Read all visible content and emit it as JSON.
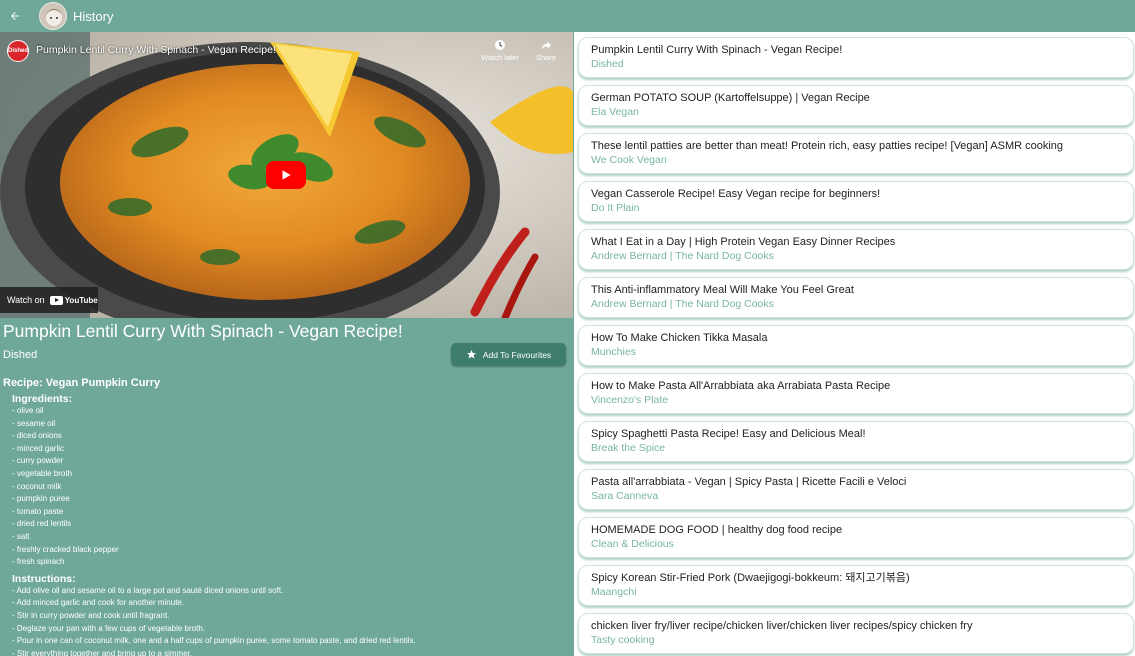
{
  "appbar": {
    "title": "History",
    "back_icon": "arrow-left-icon"
  },
  "player": {
    "title": "Pumpkin Lentil Curry With Spinach - Vegan Recipe!",
    "channel_logo_text": "Dished",
    "watch_later_label": "Watch later",
    "share_label": "Share",
    "watch_on_label": "Watch on",
    "youtube_label": "YouTube"
  },
  "video": {
    "heading": "Pumpkin Lentil Curry With Spinach - Vegan Recipe!",
    "channel": "Dished",
    "fav_button_label": "Add To Favourites"
  },
  "recipe": {
    "title": "Recipe: Vegan Pumpkin Curry",
    "ingredients_heading": "Ingredients:",
    "ingredients": [
      "- olive oil",
      "- sesame oil",
      "- diced onions",
      "- minced garlic",
      "- curry powder",
      "- vegetable broth",
      "- coconut milk",
      "- pumpkin puree",
      "- tomato paste",
      "- dried red lentils",
      "- salt",
      "- freshly cracked black pepper",
      "- fresh spinach"
    ],
    "instructions_heading": "Instructions:",
    "instructions": [
      "- Add olive oil and sesame oil to a large pot and sauté diced onions until soft.",
      "- Add minced garlic and cook for another minute.",
      "- Stir in curry powder and cook until fragrant.",
      "- Deglaze your pan with a few cups of vegetable broth.",
      "- Pour in one can of coconut milk, one and a half cups of pumpkin puree, some tomato paste, and dried red lentils.",
      "- Stir everything together and bring up to a simmer."
    ]
  },
  "history": [
    {
      "title": "Pumpkin Lentil Curry With Spinach - Vegan Recipe!",
      "channel": "Dished"
    },
    {
      "title": "German POTATO SOUP (Kartoffelsuppe) | Vegan Recipe",
      "channel": "Ela Vegan"
    },
    {
      "title": "These lentil patties are better than meat! Protein rich, easy patties recipe! [Vegan] ASMR cooking",
      "channel": "We Cook Vegan"
    },
    {
      "title": "Vegan Casserole Recipe! Easy Vegan recipe for beginners!",
      "channel": "Do It Plain"
    },
    {
      "title": "What I Eat in a Day |  High Protein Vegan Easy Dinner Recipes",
      "channel": "Andrew Bernard | The Nard Dog Cooks"
    },
    {
      "title": "This Anti-inflammatory Meal Will Make You Feel Great",
      "channel": "Andrew Bernard | The Nard Dog Cooks"
    },
    {
      "title": "How To Make Chicken Tikka Masala",
      "channel": "Munchies"
    },
    {
      "title": "How to Make Pasta All'Arrabbiata aka Arrabiata Pasta Recipe",
      "channel": "Vincenzo's Plate"
    },
    {
      "title": "Spicy Spaghetti Pasta Recipe! Easy and Delicious Meal!",
      "channel": "Break the Spice"
    },
    {
      "title": "Pasta all'arrabbiata - Vegan | Spicy Pasta | Ricette Facili e Veloci",
      "channel": "Sara Canneva"
    },
    {
      "title": "HOMEMADE DOG FOOD | healthy dog food recipe",
      "channel": "Clean & Delicious"
    },
    {
      "title": "Spicy Korean Stir-Fried Pork (Dwaejigogi-bokkeum: 돼지고기볶음)",
      "channel": "Maangchi"
    },
    {
      "title": "chicken liver fry/liver recipe/chicken liver/chicken liver recipes/spicy chicken fry",
      "channel": "Tasty cooking"
    }
  ],
  "colors": {
    "primary": "#6fa899",
    "button": "#3e7d6d",
    "channel_text": "#78b5a4",
    "youtube_red": "#ff0000"
  }
}
